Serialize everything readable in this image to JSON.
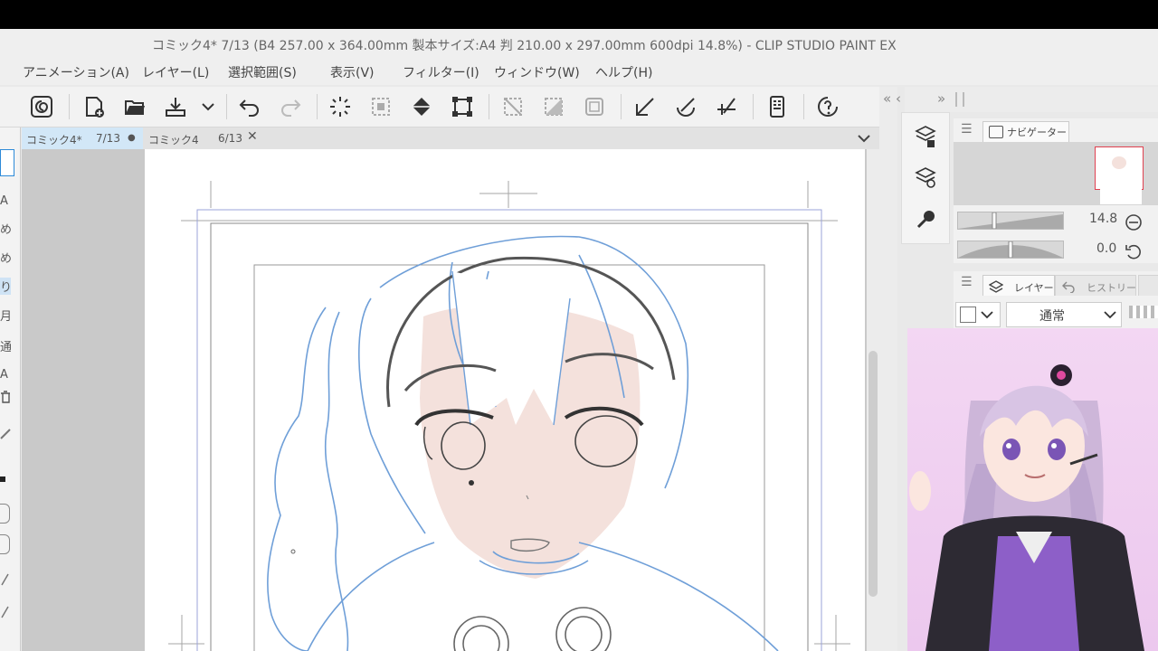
{
  "title_bar": {
    "text": "コミック4* 7/13 (B4 257.00 x 364.00mm 製本サイズ:A4 判 210.00 x 297.00mm 600dpi 14.8%)  - CLIP STUDIO PAINT EX"
  },
  "menu": {
    "animation": "アニメーション(A)",
    "layer": "レイヤー(L)",
    "selection": "選択範囲(S)",
    "view": "表示(V)",
    "filter": "フィルター(I)",
    "window": "ウィンドウ(W)",
    "help": "ヘルプ(H)"
  },
  "toolbar": {
    "icons": [
      "clip-studio-icon",
      "new-file-icon",
      "open-folder-icon",
      "save-icon",
      "save-dropdown-icon",
      "undo-icon",
      "redo-icon",
      "loading-spinner-icon",
      "clear-selection-icon",
      "fill-icon",
      "transform-icon",
      "deselect-icon",
      "invert-selection-icon",
      "show-selection-icon",
      "ruler-pen-icon",
      "ruler-brush-icon",
      "ruler-line-icon",
      "tablet-icon",
      "help-icon"
    ]
  },
  "tabs": [
    {
      "name": "コミック4*",
      "page": "7/13",
      "modified_marker": "●",
      "active": true
    },
    {
      "name": "コミック4",
      "page": "6/13",
      "close": "✕",
      "active": false
    }
  ],
  "tab_dropdown": "chevron-down-icon",
  "left_strip_glyphs": [
    "A",
    "め",
    "め",
    "り",
    "月",
    "通",
    "A"
  ],
  "panel_header": {
    "left_arrows": "« ‹",
    "right_arrows": "»"
  },
  "navigator": {
    "tab_label": "ナビゲーター",
    "zoom_value": "14.8",
    "rotation_value": "0.0"
  },
  "layer_panel": {
    "tab_layer": "レイヤー",
    "tab_history": "ヒストリー",
    "blend_mode": "通常"
  },
  "colors": {
    "accent_tab": "#d2e7f7",
    "sketch_blue": "#6f9fd8",
    "skin_tone": "#f4e1dc",
    "thumbnail_border": "#e04050"
  }
}
